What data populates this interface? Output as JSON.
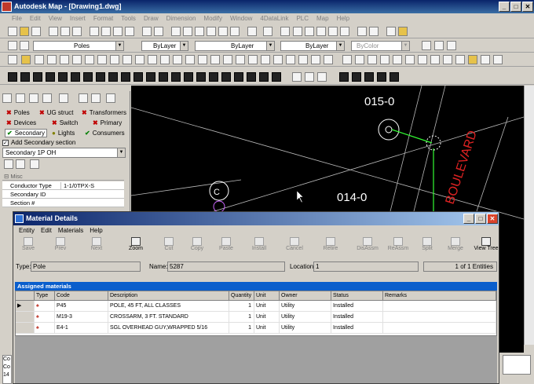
{
  "app": {
    "title": "Autodesk Map - [Drawing1.dwg]"
  },
  "menu": [
    "File",
    "Edit",
    "View",
    "Insert",
    "Format",
    "Tools",
    "Draw",
    "Dimension",
    "Modify",
    "Window",
    "4DataLink",
    "PLC",
    "Map",
    "Help"
  ],
  "toolbar": {
    "layer_combo": "Poles",
    "color_combo": "ByLayer",
    "linetype_combo": "ByLayer",
    "lineweight_combo": "ByLayer",
    "plotstyle_combo": "ByColor"
  },
  "left_panel": {
    "categories": [
      {
        "mark": "✖",
        "label": "Poles",
        "color": "#c00000"
      },
      {
        "mark": "✖",
        "label": "UG struct",
        "color": "#c00000"
      },
      {
        "mark": "✖",
        "label": "Transformers",
        "color": "#c00000"
      },
      {
        "mark": "✖",
        "label": "Devices",
        "color": "#c00000"
      },
      {
        "mark": "✖",
        "label": "Switch",
        "color": "#c00000"
      },
      {
        "mark": "✖",
        "label": "Primary",
        "color": "#c00000"
      },
      {
        "mark": "✔",
        "label": "Secondary",
        "color": "#008000"
      },
      {
        "mark": "●",
        "label": "Lights",
        "color": "#808000"
      },
      {
        "mark": "✔",
        "label": "Consumers",
        "color": "#008000"
      }
    ],
    "add_section_label": "Add Secondary section",
    "add_section_checked": true,
    "section_select": "Secondary 1P OH",
    "misc_header": "Misc",
    "properties": [
      {
        "key": "Conductor Type",
        "value": "1-1/0TPX-S"
      },
      {
        "key": "Secondary ID",
        "value": ""
      },
      {
        "key": "Section #",
        "value": ""
      }
    ]
  },
  "drawing": {
    "labels": [
      "015-0",
      "014-0",
      "BOULEVARD",
      "C"
    ]
  },
  "dialog": {
    "title": "Material Details",
    "menu": [
      "Entity",
      "Edit",
      "Materials",
      "Help"
    ],
    "tools": [
      {
        "label": "Save",
        "enabled": false
      },
      {
        "label": "Prev",
        "enabled": false
      },
      {
        "label": "Next",
        "enabled": false
      },
      {
        "label": "Zoom",
        "enabled": true
      },
      {
        "label": "Cut",
        "enabled": false
      },
      {
        "label": "Copy",
        "enabled": false
      },
      {
        "label": "Paste",
        "enabled": false
      },
      {
        "label": "Install",
        "enabled": false
      },
      {
        "label": "Cancel",
        "enabled": false
      },
      {
        "label": "Retire",
        "enabled": false
      },
      {
        "label": "DisAssm",
        "enabled": false
      },
      {
        "label": "ReAssm",
        "enabled": false
      },
      {
        "label": "Split",
        "enabled": false
      },
      {
        "label": "Merge",
        "enabled": false
      },
      {
        "label": "View Tree",
        "enabled": true
      }
    ],
    "type_label": "Type:",
    "type_value": "Pole",
    "name_label": "Name:",
    "name_value": "5287",
    "location_label": "Location:",
    "location_value": "1",
    "entities": "1 of 1 Entities",
    "section_title": "Assigned materials",
    "columns": [
      "Type",
      "Code",
      "Description",
      "Quantity",
      "Unit",
      "Owner",
      "Status",
      "Remarks"
    ],
    "rows": [
      {
        "code": "P45",
        "description": "POLE, 45 FT, ALL CLASSES",
        "quantity": "1",
        "unit": "Unit",
        "owner": "Utility",
        "status": "Installed",
        "remarks": ""
      },
      {
        "code": "M19-3",
        "description": "CROSSARM, 3 FT. STANDARD",
        "quantity": "1",
        "unit": "Unit",
        "owner": "Utility",
        "status": "Installed",
        "remarks": ""
      },
      {
        "code": "E4-1",
        "description": "SGL OVERHEAD GUY,WRAPPED 5/16",
        "quantity": "1",
        "unit": "Unit",
        "owner": "Utility",
        "status": "Installed",
        "remarks": ""
      }
    ]
  },
  "command_line": {
    "partial": [
      "Co",
      "Co",
      "14"
    ]
  }
}
